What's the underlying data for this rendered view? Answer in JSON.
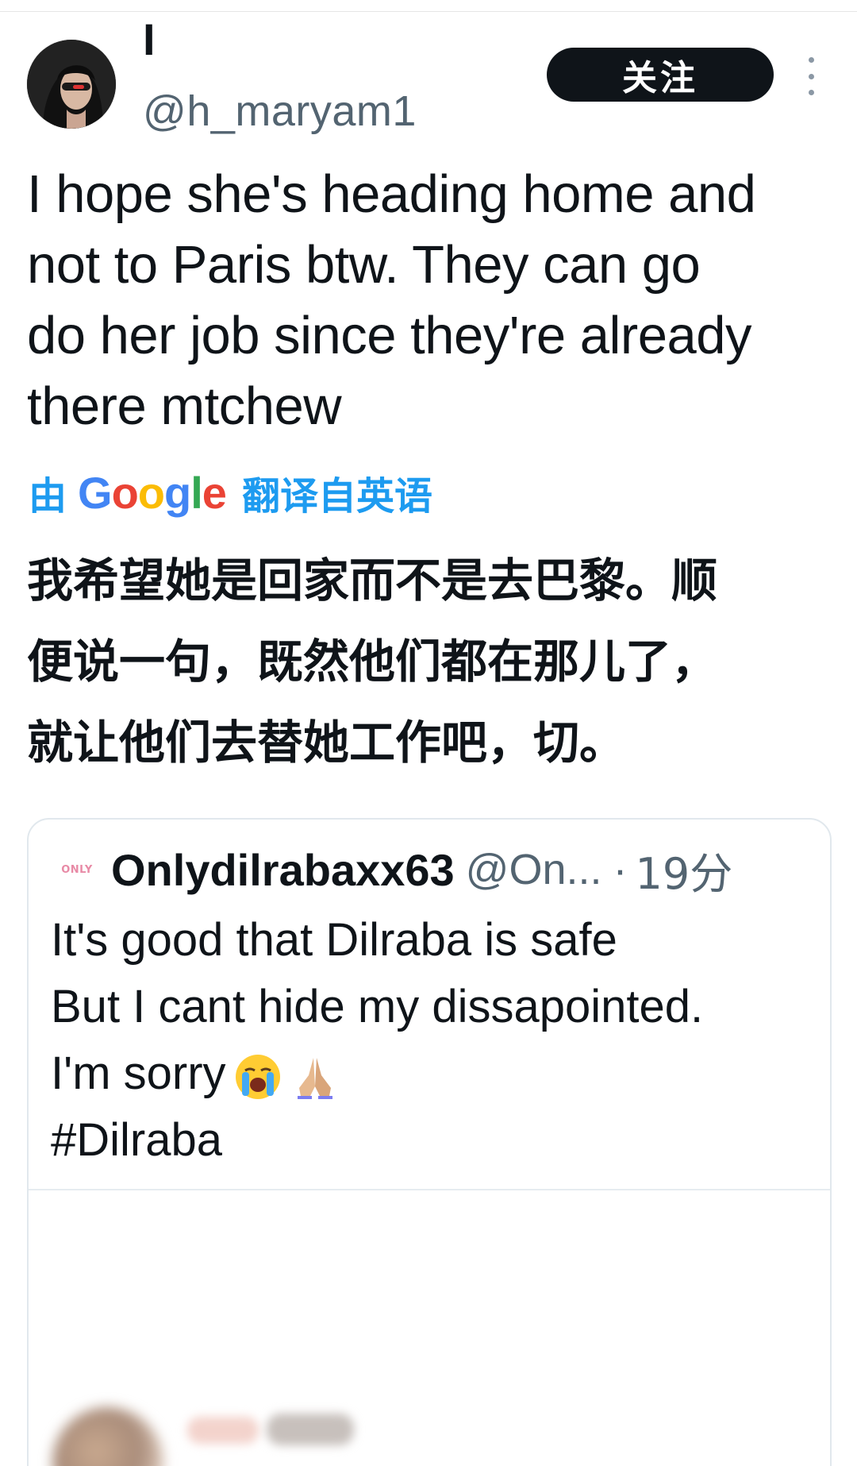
{
  "author": {
    "display_name": "I",
    "handle": "@h_maryam1"
  },
  "actions": {
    "follow_label": "关注",
    "more_icon": "more-vertical-icon"
  },
  "tweet": {
    "text_lines": [
      "I hope she's heading home and",
      "not to Paris btw. They can go",
      "do her job since they're already",
      "there mtchew"
    ],
    "translate_prefix": "由",
    "translate_provider": "Google",
    "translate_suffix": "翻译自英语",
    "translation_lines": [
      "我希望她是回家而不是去巴黎。顺",
      "便说一句，既然他们都在那儿了，",
      "就让他们去替她工作吧，切。"
    ]
  },
  "quote": {
    "avatar_text": "ONLY",
    "name": "Onlydilrabaxx63",
    "handle": "@On...",
    "separator": "·",
    "time": "19分",
    "body_lines": [
      "It's good that Dilraba is safe",
      "But I cant hide my dissapointed.",
      "I'm sorry"
    ],
    "emojis": [
      "loudly-crying-face-icon",
      "folded-hands-icon"
    ],
    "hashtag": "#Dilraba"
  },
  "colors": {
    "link": "#1d9bf0",
    "text": "#0f1419",
    "secondary": "#536471",
    "follow_bg": "#0f1419"
  }
}
